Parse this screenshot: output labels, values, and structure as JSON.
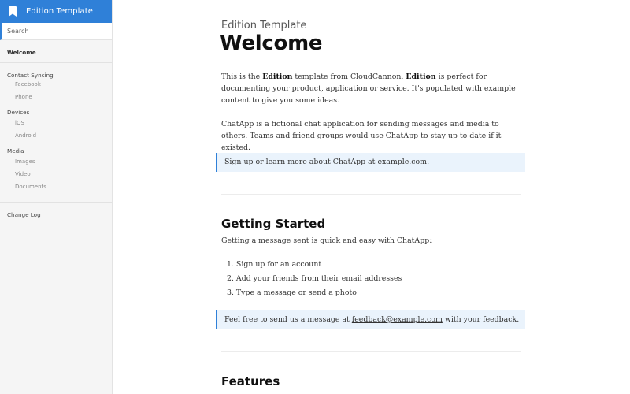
{
  "sidebar": {
    "brand": "Edition Template",
    "search_placeholder": "Search",
    "welcome": "Welcome",
    "sections": [
      {
        "title": "Contact Syncing",
        "items": [
          "Facebook",
          "Phone"
        ]
      },
      {
        "title": "Devices",
        "items": [
          "iOS",
          "Android"
        ]
      },
      {
        "title": "Media",
        "items": [
          "Images",
          "Video",
          "Documents"
        ]
      }
    ],
    "changelog": "Change Log"
  },
  "main": {
    "kicker": "Edition Template",
    "title": "Welcome",
    "intro": {
      "t1": "This is the ",
      "b1": "Edition",
      "t2": " template from ",
      "link1": "CloudCannon",
      "t3": ". ",
      "b2": "Edition",
      "t4": " is perfect for documenting your product, application or service. It's populated with example content to give you some ideas."
    },
    "para2": "ChatApp is a fictional chat application for sending messages and media to others. Teams and friend groups would use ChatApp to stay up to date if it existed.",
    "callout1": {
      "link": "Sign up",
      "t1": " or learn more about ChatApp at ",
      "link2": "example.com",
      "t2": "."
    },
    "getting_started": {
      "heading": "Getting Started",
      "para": "Getting a message sent is quick and easy with ChatApp:",
      "steps": [
        "1. Sign up for an account",
        "2. Add your friends from their email addresses",
        "3. Type a message or send a photo"
      ]
    },
    "callout2": {
      "t1": "Feel free to send us a message at ",
      "link": "feedback@example.com",
      "t2": " with your feedback."
    },
    "features_heading": "Features"
  },
  "colors": {
    "accent": "#2f80d8",
    "callout_bg": "#eaf3fc",
    "sidebar_bg": "#f5f5f5"
  }
}
